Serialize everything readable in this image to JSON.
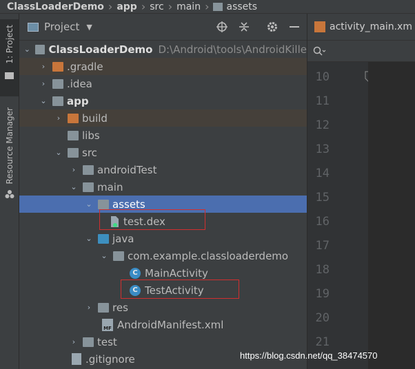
{
  "breadcrumb": {
    "project": "ClassLoaderDemo",
    "module": "app",
    "src": "src",
    "main": "main",
    "assets": "assets"
  },
  "tool_stripe": {
    "project_label": "1: Project",
    "resource_manager_label": "Resource Manager"
  },
  "panel": {
    "title": "Project"
  },
  "tree": {
    "root_label": "ClassLoaderDemo",
    "root_path": "D:\\Android\\tools\\AndroidKille",
    "gradle": ".gradle",
    "idea": ".idea",
    "app": "app",
    "build": "build",
    "libs": "libs",
    "src": "src",
    "androidTest": "androidTest",
    "main": "main",
    "assets": "assets",
    "test_dex": "test.dex",
    "java": "java",
    "package": "com.example.classloaderdemo",
    "main_activity": "MainActivity",
    "test_activity": "TestActivity",
    "res": "res",
    "manifest": "AndroidManifest.xml",
    "test": "test",
    "gitignore": ".gitignore"
  },
  "editor": {
    "tab_label": "activity_main.xm",
    "line_numbers": [
      "10",
      "11",
      "12",
      "13",
      "14",
      "15",
      "16",
      "17",
      "18",
      "19",
      "20",
      "21"
    ]
  },
  "watermark": "https://blog.csdn.net/qq_38474570",
  "colors": {
    "selection": "#4b6eaf",
    "highlight_box": "#d12f2f",
    "folder_orange": "#c8763b",
    "folder_blue": "#3d8fbf"
  }
}
